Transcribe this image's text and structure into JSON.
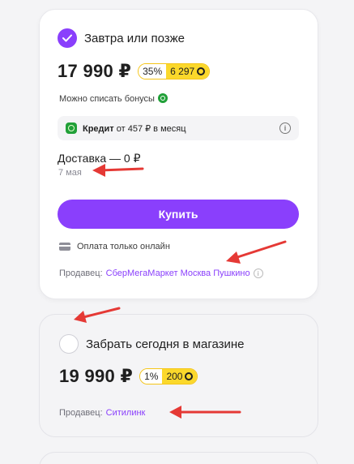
{
  "option_1": {
    "title": "Завтра или позже",
    "price": "17 990 ₽",
    "bonus_percent": "35%",
    "bonus_amount": "6 297",
    "can_use_bonus": "Можно списать бонусы",
    "credit_label": "Кредит",
    "credit_text": "от 457 ₽ в месяц",
    "delivery": "Доставка — 0 ₽",
    "delivery_date": "7 мая",
    "buy_label": "Купить",
    "payment_note": "Оплата только онлайн",
    "seller_prefix": "Продавец:",
    "seller_name": "СберМегаМаркет Москва Пушкино"
  },
  "option_2": {
    "title": "Забрать сегодня в магазине",
    "price": "19 990 ₽",
    "bonus_percent": "1%",
    "bonus_amount": "200",
    "seller_prefix": "Продавец:",
    "seller_name": "Ситилинк"
  },
  "colors": {
    "accent": "#8a3ffc",
    "bonus_yellow": "#fbd82b",
    "sber_green": "#21a038",
    "annotation_red": "#e53935"
  },
  "icons": {
    "checked": "check-icon",
    "bonus": "bonus-coin-icon",
    "sber": "sber-logo-icon",
    "info": "info-icon",
    "card": "credit-card-icon"
  }
}
